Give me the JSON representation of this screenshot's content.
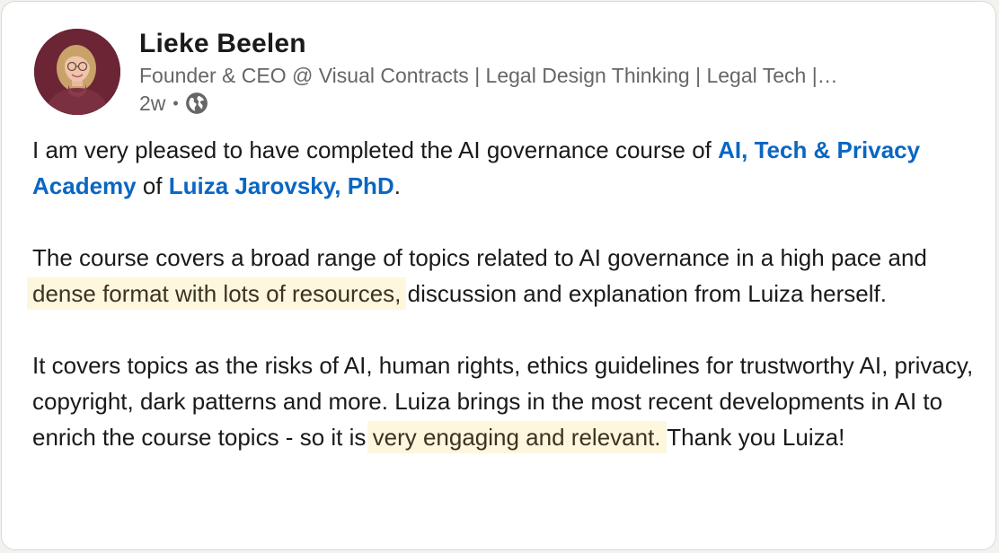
{
  "author": {
    "name": "Lieke Beelen",
    "headline": "Founder & CEO @ Visual Contracts | Legal Design Thinking | Legal Tech |…",
    "time_ago": "2w",
    "separator": "•",
    "visibility_icon": "globe-icon"
  },
  "post": {
    "p1": {
      "text_before": "I am very pleased to have completed the AI governance course of ",
      "mention_1": "AI, Tech & Privacy Academy",
      "text_middle": " of ",
      "mention_2": "Luiza Jarovsky, PhD",
      "text_after": "."
    },
    "p2": {
      "text_before": "The course covers a broad range of topics related to AI governance in a high pace and ",
      "highlight": "dense format with lots of resources,",
      "text_after": " discussion and explanation from Luiza herself."
    },
    "p3": {
      "text_before": "It covers topics as the risks of AI, human rights, ethics guidelines for trustworthy AI, privacy, copyright, dark patterns and more. Luiza brings in the most recent developments in AI to enrich the course topics - so it is ",
      "highlight_1": "very engaging and",
      "text_space": " ",
      "highlight_2": "relevant.",
      "text_after": " Thank you Luiza!"
    }
  },
  "colors": {
    "mention": "#0a66c2",
    "highlight_bg": "#fdf7de",
    "avatar_bg": "#6b2534",
    "secondary_text": "#666666"
  }
}
